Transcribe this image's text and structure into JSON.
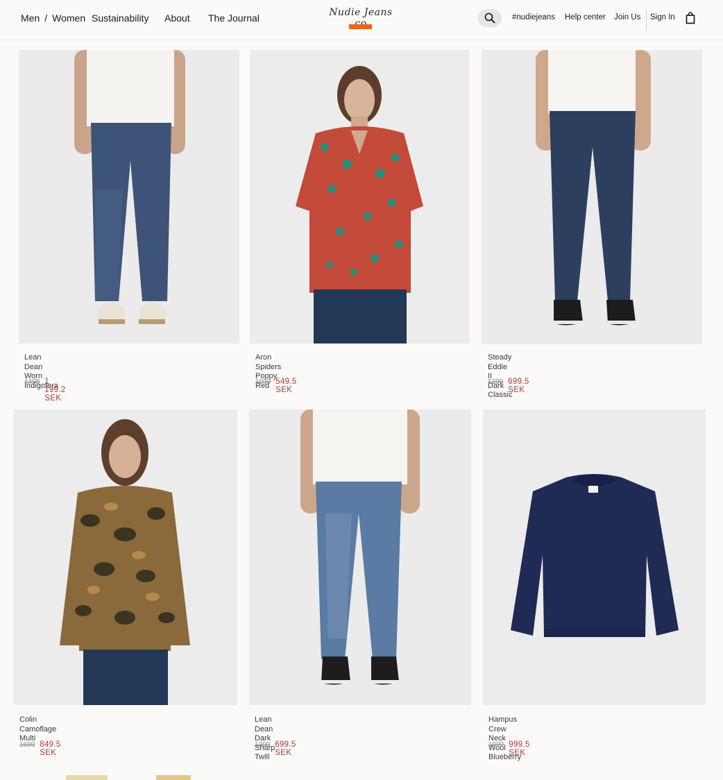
{
  "header": {
    "nav": {
      "men": "Men",
      "separator": "/",
      "women": "Women",
      "sustainability": "Sustainability",
      "about": "About",
      "journal": "The Journal"
    },
    "logo_text": "Nudie Jeans co",
    "search_icon": "search-icon",
    "links": {
      "hashtag": "#nudiejeans",
      "help": "Help center",
      "join": "Join Us",
      "sign_in": "Sign In"
    },
    "bag_icon": "shopping-bag-icon",
    "accent_color": "#e8661e"
  },
  "products": [
    {
      "name": "Lean Dean",
      "variant": "Worn Indigofera",
      "old_price": "1499",
      "new_price": "1 199.2 SEK"
    },
    {
      "name": "Aron",
      "variant": "Spiders Poppy Red",
      "old_price": "1099",
      "new_price": "549.5 SEK"
    },
    {
      "name": "Steady Eddie II",
      "variant": "Dark Classic",
      "old_price": "1399",
      "new_price": "699.5 SEK"
    },
    {
      "name": "Colin",
      "variant": "Camoflage Multi",
      "old_price": "1699",
      "new_price": "849.5 SEK"
    },
    {
      "name": "Lean Dean",
      "variant": "Dark Sharp Twill",
      "old_price": "1399",
      "new_price": "699.5 SEK"
    },
    {
      "name": "Hampus",
      "variant": "Crew Neck Wool Blueberry",
      "old_price": "1999",
      "new_price": "999.5 SEK"
    }
  ],
  "colors": {
    "sale_price": "#b13a36",
    "old_price": "#8c8c8c",
    "background": "#fbfaf8"
  }
}
